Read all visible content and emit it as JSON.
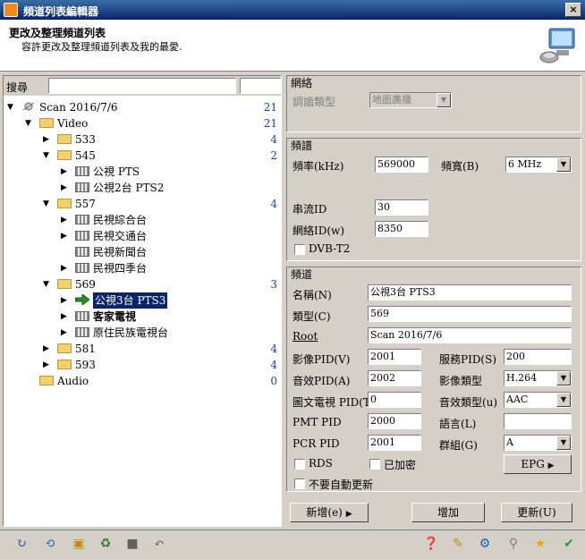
{
  "window": {
    "title": "頻道列表編輯器",
    "close": "×"
  },
  "header": {
    "title": "更改及整理頻道列表",
    "subtitle": "容許更改及整理頻道列表及我的最愛."
  },
  "search": {
    "label": "搜尋",
    "value": ""
  },
  "tree": [
    {
      "label": "Scan 2016/7/6",
      "count": "21"
    },
    {
      "label": "Video",
      "count": "21"
    },
    {
      "label": "533",
      "count": "4"
    },
    {
      "label": "545",
      "count": "2"
    },
    {
      "label": "公視 PTS",
      "count": ""
    },
    {
      "label": "公視2台 PTS2",
      "count": ""
    },
    {
      "label": "557",
      "count": "4"
    },
    {
      "label": "民視綜合台",
      "count": ""
    },
    {
      "label": "民視交通台",
      "count": ""
    },
    {
      "label": "民視新聞台",
      "count": ""
    },
    {
      "label": "民視四季台",
      "count": ""
    },
    {
      "label": "569",
      "count": "3"
    },
    {
      "label": "公視3台 PTS3",
      "count": ""
    },
    {
      "label": "客家電視",
      "count": ""
    },
    {
      "label": "原住民族電視台",
      "count": ""
    },
    {
      "label": "581",
      "count": "4"
    },
    {
      "label": "593",
      "count": "4"
    },
    {
      "label": "Audio",
      "count": "0"
    }
  ],
  "network": {
    "title": "網絡",
    "mod_label": "調諧類型",
    "mod_value": "地面廣播"
  },
  "tuning": {
    "title": "頻譜",
    "freq_label": "頻率(kHz)",
    "freq_value": "569000",
    "bw_label": "頻寬(B)",
    "bw_value": "6 MHz",
    "tsid_label": "串流ID",
    "tsid_value": "30",
    "nid_label": "網絡ID(w)",
    "nid_value": "8350",
    "dvbt2_label": "DVB-T2"
  },
  "channel": {
    "title": "頻道",
    "name_label": "名稱(N)",
    "name_value": "公視3台 PTS3",
    "type_label": "類型(C)",
    "type_value": "569",
    "root_label": "Root",
    "root_value": "Scan 2016/7/6",
    "vpid_label": "影像PID(V)",
    "vpid_value": "2001",
    "sid_label": "服務PID(S)",
    "sid_value": "200",
    "apid_label": "音效PID(A)",
    "apid_value": "2002",
    "vtype_label": "影像類型",
    "vtype_value": "H.264",
    "ttx_label": "圖文電視 PID(T)",
    "ttx_value": "0",
    "atype_label": "音效類型(u)",
    "atype_value": "AAC",
    "pmt_label": "PMT PID",
    "pmt_value": "2000",
    "lang_label": "語言(L)",
    "lang_value": "",
    "pcr_label": "PCR PID",
    "pcr_value": "2001",
    "group_label": "群組(G)",
    "group_value": "A",
    "rds_label": "RDS",
    "enc_label": "已加密",
    "epg_label": "EPG",
    "noupdate_label": "不要自動更新"
  },
  "buttons": {
    "add_new": "新增(e)",
    "add": "增加",
    "update": "更新(U)"
  }
}
